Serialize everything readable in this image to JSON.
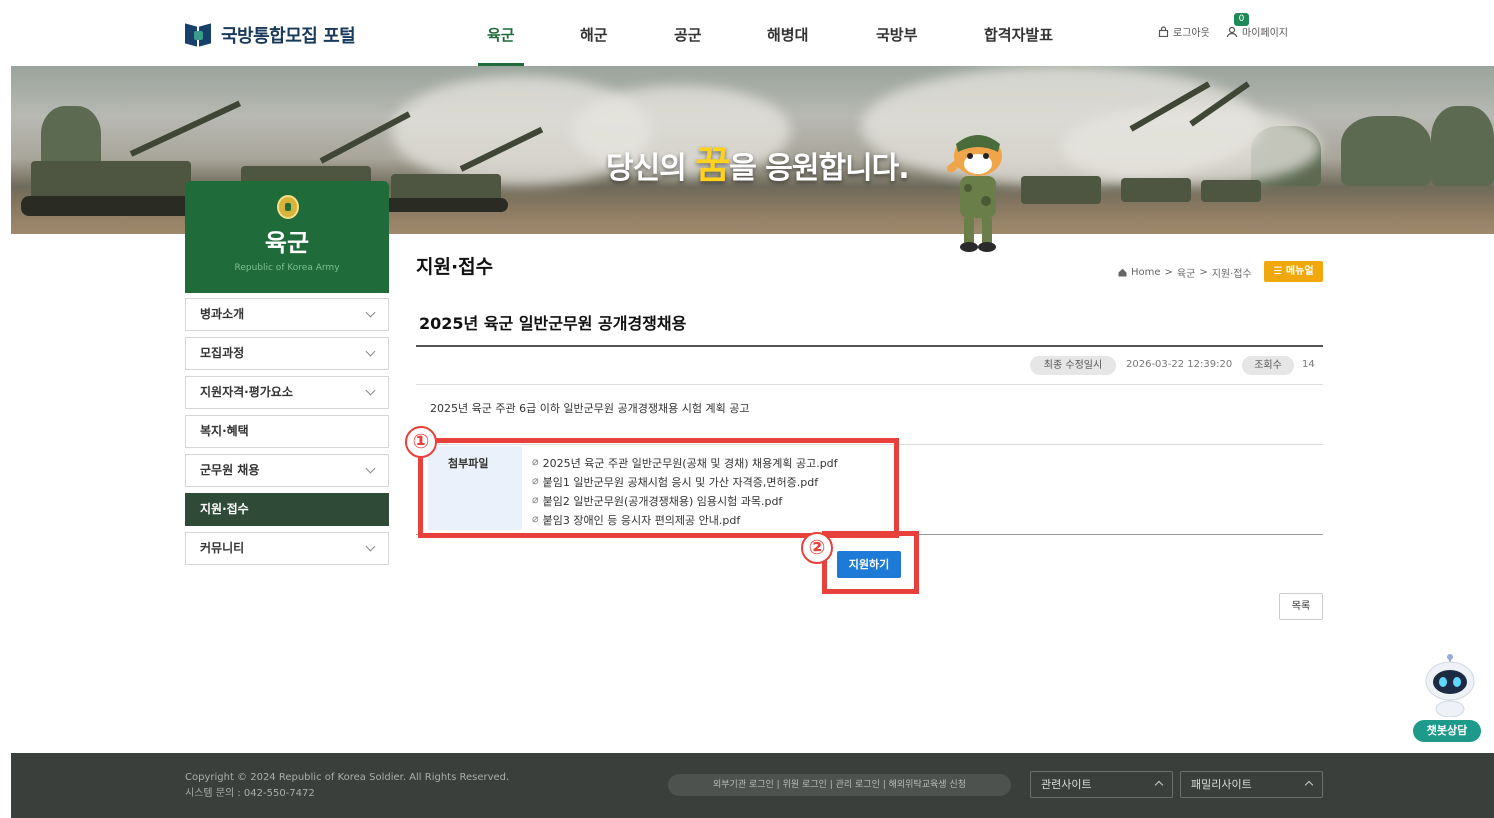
{
  "header": {
    "logo_text": "국방통합모집 포털",
    "nav": [
      "육군",
      "해군",
      "공군",
      "해병대",
      "국방부",
      "합격자발표"
    ],
    "active_nav": "육군",
    "logout_label": "로그아웃",
    "mypage_label": "마이페이지",
    "mypage_badge": "0"
  },
  "banner": {
    "slogan_pre": "당신의 ",
    "slogan_highlight": "꿈",
    "slogan_post": "을 응원합니다."
  },
  "sidebar": {
    "title": "육군",
    "subtitle": "Republic of Korea Army",
    "items": [
      {
        "label": "병과소개",
        "expandable": true
      },
      {
        "label": "모집과정",
        "expandable": true
      },
      {
        "label": "지원자격·평가요소",
        "expandable": true
      },
      {
        "label": "복지·혜택",
        "expandable": false
      },
      {
        "label": "군무원 채용",
        "expandable": true
      },
      {
        "label": "지원·접수",
        "expandable": false,
        "active": true
      },
      {
        "label": "커뮤니티",
        "expandable": true
      }
    ]
  },
  "content": {
    "page_title": "지원·접수",
    "breadcrumb": [
      "Home",
      "육군",
      "지원·접수"
    ],
    "manual_label": "메뉴얼",
    "post_title": "2025년 육군 일반군무원 공개경쟁채용",
    "meta": {
      "updated_label": "최종 수정일시",
      "updated_value": "2026-03-22 12:39:20",
      "views_label": "조회수",
      "views_value": "14"
    },
    "body": "2025년 육군 주관 6급 이하 일반군무원 공개경쟁채용 시험 계획 공고",
    "attachments_label": "첨부파일",
    "attachments": [
      "2025년 육군 주관 일반군무원(공채 및 경채) 채용계획 공고.pdf",
      "붙임1 일반군무원 공채시험 응시 및 가산 자격증,면허증.pdf",
      "붙임2 일반군무원(공개경쟁채용) 임용시험 과목.pdf",
      "붙임3 장애인 등 응시자 편의제공 안내.pdf"
    ],
    "apply_label": "지원하기",
    "list_label": "목록"
  },
  "annotations": [
    "①",
    "②"
  ],
  "chatbot_label": "챗봇상담",
  "footer": {
    "copyright": "Copyright © 2024 Republic of Korea Soldier. All Rights Reserved.",
    "contact": "시스템 문의 : 042-550-7472",
    "links": "외부기관 로그인  |  위원 로그인  |  관리 로그인  |  해외위탁교육생 신청",
    "related_sites": "관련사이트",
    "family_sites": "패밀리사이트"
  },
  "colors": {
    "army_green": "#1f6b3a",
    "apply_blue": "#1d7ad6",
    "annotation_red": "#e8403a",
    "manual_orange": "#f0a80c"
  }
}
